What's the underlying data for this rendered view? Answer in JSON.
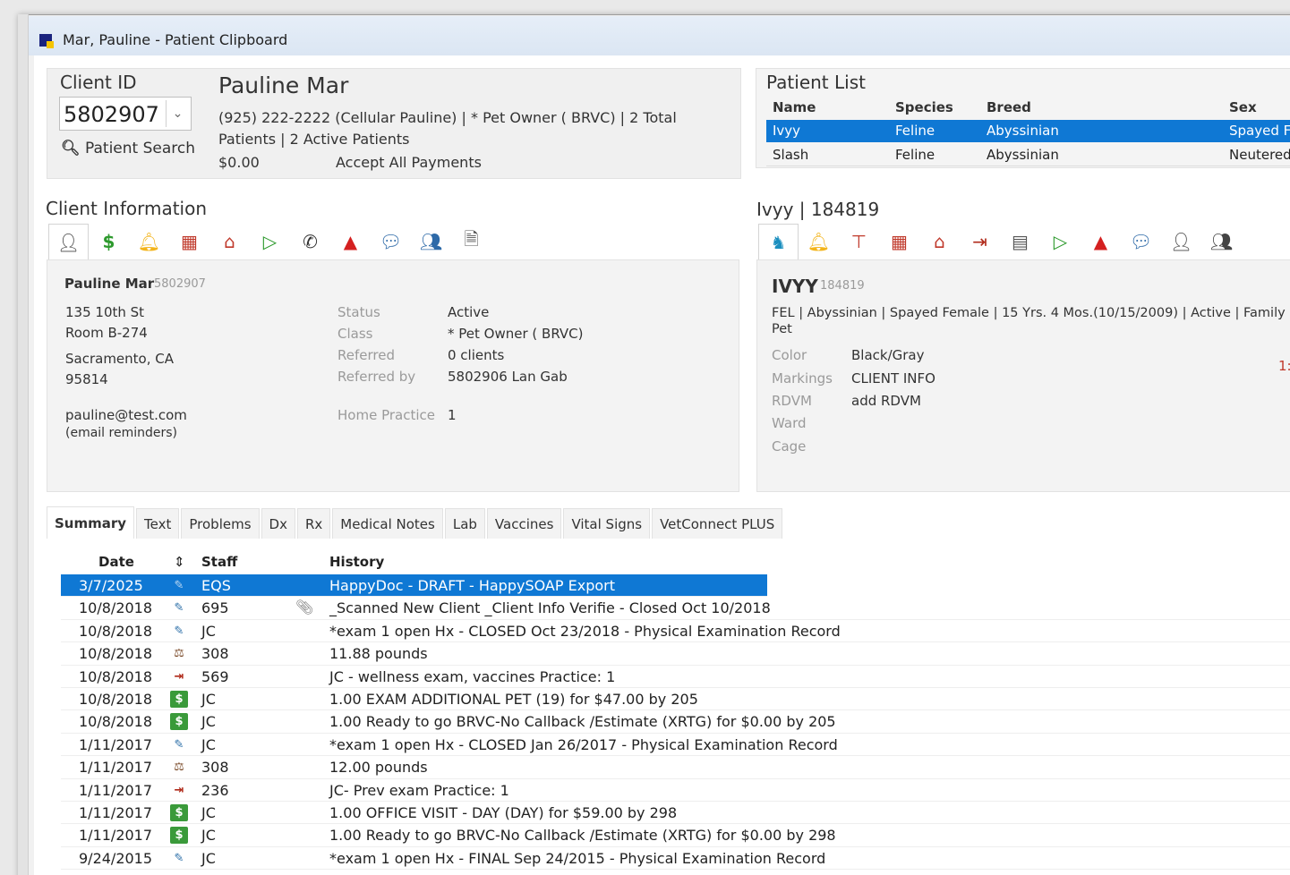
{
  "window": {
    "title": "Mar, Pauline - Patient Clipboard"
  },
  "client": {
    "id_label": "Client ID",
    "id_value": "5802907",
    "patient_search": "Patient Search",
    "name": "Pauline Mar",
    "line1": "(925) 222-2222  (Cellular  Pauline) | * Pet Owner ( BRVC) | 2 Total",
    "line2": "Patients | 2 Active Patients",
    "balance": "$0.00",
    "payments": "Accept All Payments"
  },
  "patient_list": {
    "label": "Patient List",
    "columns": [
      "Name",
      "Species",
      "Breed",
      "Sex"
    ],
    "rows": [
      {
        "name": "Ivyy",
        "species": "Feline",
        "breed": "Abyssinian",
        "sex": "Spayed Fe"
      },
      {
        "name": "Slash",
        "species": "Feline",
        "breed": "Abyssinian",
        "sex": "Neutered"
      }
    ]
  },
  "client_info": {
    "label": "Client Information",
    "icons": [
      "person-icon",
      "dollar-icon",
      "bell-icon",
      "calendar-icon",
      "house-icon",
      "checkout-icon",
      "phone-icon",
      "alert-icon",
      "chat-icon",
      "contacts-icon",
      "document-icon"
    ],
    "name": "Pauline Mar",
    "id": "5802907",
    "address1": "135 10th St",
    "address2": "Room B-274",
    "city": "Sacramento, CA",
    "zip": "95814",
    "email": "pauline@test.com",
    "email_note": "(email reminders)",
    "fields": [
      {
        "label": "Status",
        "value": "Active"
      },
      {
        "label": "Class",
        "value": "* Pet Owner ( BRVC)"
      },
      {
        "label": "Referred",
        "value": "0 clients"
      },
      {
        "label": "Referred by",
        "value": "5802906  Lan Gab"
      },
      {
        "label": "Home Practice",
        "value": "1"
      }
    ]
  },
  "patient": {
    "header": "Ivyy | 184819",
    "icons": [
      "animal-icon",
      "bell-icon",
      "scale-icon",
      "calendar-icon",
      "house-icon",
      "checkin-icon",
      "chart-icon",
      "checkout-icon",
      "alert-icon",
      "chat-icon",
      "person-icon",
      "people-icon"
    ],
    "name": "IVYY",
    "id": "184819",
    "desc1": "FEL | Abyssinian | Spayed Female | 15 Yrs. 4 Mos.(10/15/2009) | Active | Family",
    "desc2": "Pet",
    "side_mark": "1:",
    "fields": [
      {
        "label": "Color",
        "value": "Black/Gray"
      },
      {
        "label": "Markings",
        "value": "CLIENT INFO"
      },
      {
        "label": "RDVM",
        "value": "add RDVM"
      },
      {
        "label": "Ward",
        "value": ""
      },
      {
        "label": "Cage",
        "value": ""
      }
    ]
  },
  "tabs": [
    "Summary",
    "Text",
    "Problems",
    "Dx",
    "Rx",
    "Medical Notes",
    "Lab",
    "Vaccines",
    "Vital Signs",
    "VetConnect PLUS"
  ],
  "history": {
    "columns": {
      "date": "Date",
      "sort": "⇕",
      "staff": "Staff",
      "history": "History"
    },
    "rows": [
      {
        "date": "3/7/2025",
        "icon": "doc",
        "staff": "EQS",
        "text": "HappyDoc - DRAFT - HappySOAP Export",
        "clip": false
      },
      {
        "date": "10/8/2018",
        "icon": "doc",
        "staff": "695",
        "text": "_Scanned New Client _Client Info Verifie - Closed Oct 10/2018",
        "clip": true
      },
      {
        "date": "10/8/2018",
        "icon": "doc",
        "staff": "JC",
        "text": "*exam 1 open Hx  - CLOSED Oct 23/2018 - Physical Examination Record",
        "clip": false
      },
      {
        "date": "10/8/2018",
        "icon": "scale",
        "staff": "308",
        "text": "11.88 pounds",
        "clip": false
      },
      {
        "date": "10/8/2018",
        "icon": "exit",
        "staff": "569",
        "text": "JC - wellness exam, vaccines    Practice: 1",
        "clip": false
      },
      {
        "date": "10/8/2018",
        "icon": "dollar",
        "staff": "JC",
        "text": "1.00 EXAM ADDITIONAL PET (19) for $47.00 by 205",
        "clip": false
      },
      {
        "date": "10/8/2018",
        "icon": "dollar",
        "staff": "JC",
        "text": "1.00 Ready to go BRVC-No Callback /Estimate (XRTG) for $0.00 by 205",
        "clip": false
      },
      {
        "date": "1/11/2017",
        "icon": "doc",
        "staff": "JC",
        "text": "*exam 1 open Hx  - CLOSED Jan 26/2017 - Physical Examination Record",
        "clip": false
      },
      {
        "date": "1/11/2017",
        "icon": "scale",
        "staff": "308",
        "text": "12.00 pounds",
        "clip": false
      },
      {
        "date": "1/11/2017",
        "icon": "exit",
        "staff": "236",
        "text": "JC- Prev exam     Practice: 1",
        "clip": false
      },
      {
        "date": "1/11/2017",
        "icon": "dollar",
        "staff": "JC",
        "text": "1.00 OFFICE VISIT - DAY (DAY) for $59.00 by 298",
        "clip": false
      },
      {
        "date": "1/11/2017",
        "icon": "dollar",
        "staff": "JC",
        "text": "1.00 Ready to go BRVC-No Callback /Estimate (XRTG) for $0.00 by 298",
        "clip": false
      },
      {
        "date": "9/24/2015",
        "icon": "doc",
        "staff": "JC",
        "text": "*exam 1 open Hx  - FINAL Sep 24/2015 - Physical Examination Record",
        "clip": false
      }
    ]
  }
}
